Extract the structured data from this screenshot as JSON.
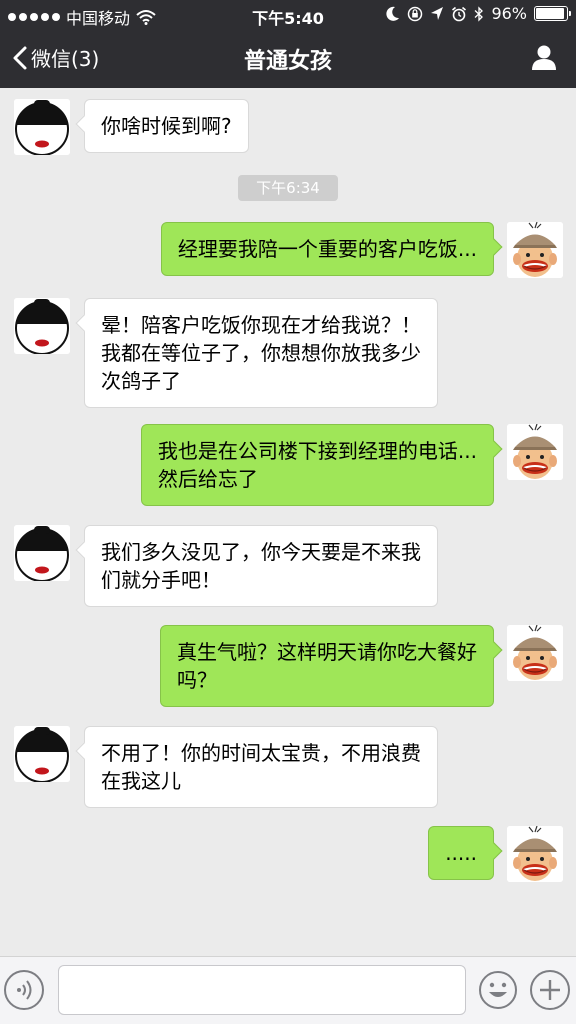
{
  "status_bar": {
    "carrier": "中国移动",
    "time": "下午5:40",
    "battery_percent": "96%",
    "battery_level": 0.96,
    "signal_bars": 5
  },
  "nav": {
    "back_label": "微信(3)",
    "title": "普通女孩",
    "icons": {
      "back": "chevron-left-icon",
      "profile": "person-icon"
    }
  },
  "timestamp": "下午6:34",
  "messages": [
    {
      "sender": "girl",
      "text": "你啥时候到啊?"
    },
    {
      "sender": "me",
      "text": "经理要我陪一个重要的客户吃饭..."
    },
    {
      "sender": "girl",
      "text": "晕！陪客户吃饭你现在才给我说？！\n我都在等位子了，你想想你放我多少\n次鸽子了"
    },
    {
      "sender": "me",
      "text": "我也是在公司楼下接到经理的电话...\n然后给忘了"
    },
    {
      "sender": "girl",
      "text": "我们多久没见了，你今天要是不来我\n们就分手吧！"
    },
    {
      "sender": "me",
      "text": "真生气啦？这样明天请你吃大餐好\n吗？"
    },
    {
      "sender": "girl",
      "text": "不用了！你的时间太宝贵，不用浪费\n在我这儿"
    },
    {
      "sender": "me",
      "text": "....."
    }
  ],
  "input_bar": {
    "placeholder": "",
    "icons": {
      "voice": "voice-icon",
      "emoji": "emoji-icon",
      "more": "plus-icon"
    }
  },
  "colors": {
    "bar_bg": "#2e2e32",
    "chat_bg": "#ebebeb",
    "bubble_out": "#9fe658",
    "bubble_in": "#ffffff"
  }
}
